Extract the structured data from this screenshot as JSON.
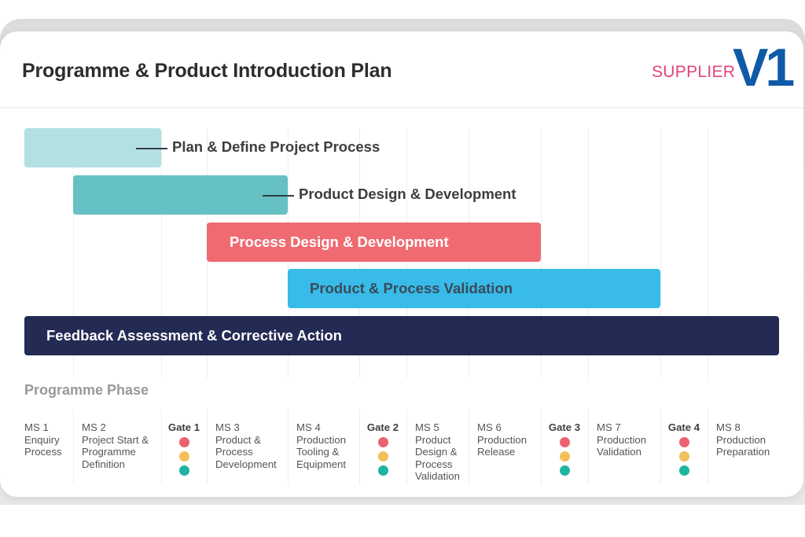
{
  "header": {
    "title": "Programme & Product Introduction Plan",
    "brand_text": "SUPPLIER",
    "brand_mark": "V1",
    "brand_text_color": "#e0457b",
    "brand_mark_color": "#0f5aa6"
  },
  "chart_data": {
    "type": "gantt",
    "title": "Programme & Product Introduction Plan",
    "xlabel": "Programme Phase",
    "columns": [
      "MS 1",
      "MS 2",
      "Gate 1",
      "MS 3",
      "MS 4",
      "Gate 2",
      "MS 5",
      "MS 6",
      "Gate 3",
      "MS 7",
      "Gate 4",
      "MS 8"
    ],
    "tasks": [
      {
        "name": "Plan & Define Project Process",
        "start_col": "MS 1",
        "end_col": "Gate 1",
        "color": "#b3e0e0",
        "label_position": "outside",
        "text_color": "#3d3d3d"
      },
      {
        "name": "Product Design & Development",
        "start_col": "MS 2",
        "end_col": "MS 3",
        "color": "#65c1c3",
        "label_position": "outside",
        "text_color": "#3d3d3d"
      },
      {
        "name": "Process Design & Development",
        "start_col": "MS 3",
        "end_col": "MS 6",
        "color": "#ef6b71",
        "label_position": "inside",
        "text_color": "#ffffff"
      },
      {
        "name": "Product & Process Validation",
        "start_col": "MS 4",
        "end_col": "MS 7",
        "color": "#38bbe8",
        "label_position": "inside",
        "text_color": "#3a4a5a"
      },
      {
        "name": "Feedback Assessment & Corrective Action",
        "start_col": "MS 1",
        "end_col": "MS 8",
        "color": "#232a54",
        "label_position": "inside",
        "text_color": "#ffffff"
      }
    ]
  },
  "phase": {
    "title": "Programme Phase",
    "items": [
      {
        "type": "ms",
        "id": "MS 1",
        "lines": [
          "Enquiry",
          "Process"
        ]
      },
      {
        "type": "ms",
        "id": "MS 2",
        "lines": [
          "Project Start &",
          "Programme",
          "Definition"
        ]
      },
      {
        "type": "gate",
        "id": "Gate 1",
        "status": [
          "red",
          "amber",
          "green"
        ]
      },
      {
        "type": "ms",
        "id": "MS 3",
        "lines": [
          "Product &",
          "Process",
          "Development"
        ]
      },
      {
        "type": "ms",
        "id": "MS 4",
        "lines": [
          "Production",
          "Tooling &",
          "Equipment"
        ]
      },
      {
        "type": "gate",
        "id": "Gate 2",
        "status": [
          "red",
          "amber",
          "green"
        ]
      },
      {
        "type": "ms",
        "id": "MS 5",
        "lines": [
          "Product",
          "Design &",
          "Process",
          "Validation"
        ]
      },
      {
        "type": "ms",
        "id": "MS 6",
        "lines": [
          "Production",
          "Release"
        ]
      },
      {
        "type": "gate",
        "id": "Gate 3",
        "status": [
          "red",
          "amber",
          "green"
        ]
      },
      {
        "type": "ms",
        "id": "MS 7",
        "lines": [
          "Production",
          "Validation"
        ]
      },
      {
        "type": "gate",
        "id": "Gate 4",
        "status": [
          "red",
          "amber",
          "green"
        ]
      },
      {
        "type": "ms",
        "id": "MS 8",
        "lines": [
          "Production",
          "Preparation"
        ]
      }
    ],
    "status_colors": {
      "red": "#ec6170",
      "amber": "#f2c05a",
      "green": "#1db5a2"
    }
  }
}
